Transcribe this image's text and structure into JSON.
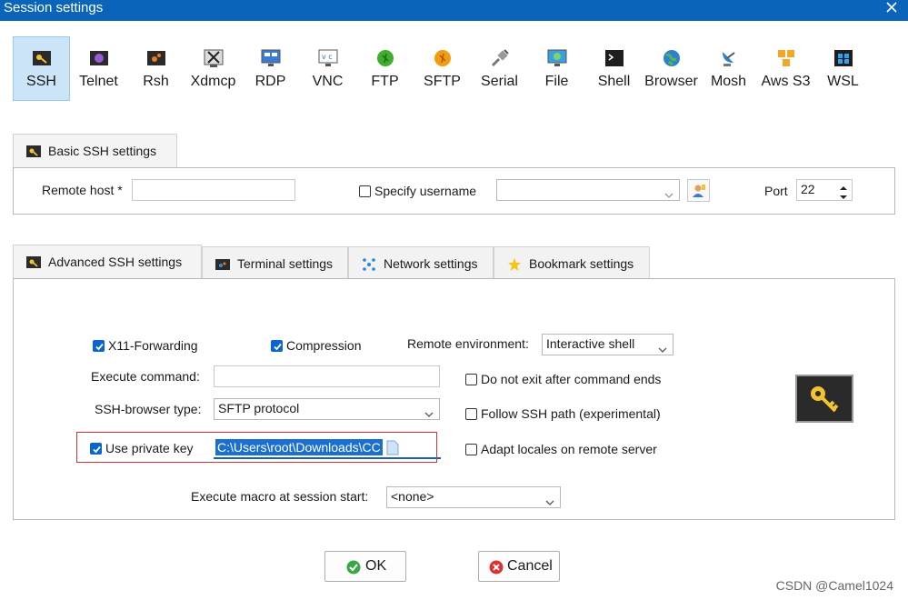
{
  "window": {
    "title": "Session settings",
    "accent": "#0a64b9"
  },
  "protocols": [
    {
      "label": "SSH",
      "icon": "ssh-key-icon",
      "active": true
    },
    {
      "label": "Telnet",
      "icon": "telnet-icon"
    },
    {
      "label": "Rsh",
      "icon": "rsh-icon"
    },
    {
      "label": "Xdmcp",
      "icon": "xdmcp-icon"
    },
    {
      "label": "RDP",
      "icon": "rdp-monitor-icon"
    },
    {
      "label": "VNC",
      "icon": "vnc-icon"
    },
    {
      "label": "FTP",
      "icon": "ftp-globe-icon"
    },
    {
      "label": "SFTP",
      "icon": "sftp-globe-icon"
    },
    {
      "label": "Serial",
      "icon": "serial-plug-icon"
    },
    {
      "label": "File",
      "icon": "file-monitor-icon"
    },
    {
      "label": "Shell",
      "icon": "shell-terminal-icon"
    },
    {
      "label": "Browser",
      "icon": "browser-globe-icon"
    },
    {
      "label": "Mosh",
      "icon": "mosh-satellite-icon"
    },
    {
      "label": "Aws S3",
      "icon": "aws-s3-cubes-icon"
    },
    {
      "label": "WSL",
      "icon": "wsl-windows-icon"
    }
  ],
  "basic": {
    "tab_label": "Basic SSH settings",
    "remote_host_label": "Remote host *",
    "remote_host_value": "",
    "specify_username_label": "Specify username",
    "specify_username_checked": false,
    "username_value": "",
    "port_label": "Port",
    "port_value": "22"
  },
  "advanced_tabs": [
    {
      "label": "Advanced SSH settings",
      "icon": "key-icon",
      "selected": true
    },
    {
      "label": "Terminal settings",
      "icon": "terminal-icon"
    },
    {
      "label": "Network settings",
      "icon": "network-icon"
    },
    {
      "label": "Bookmark settings",
      "icon": "star-icon"
    }
  ],
  "advanced": {
    "x11_label": "X11-Forwarding",
    "x11_checked": true,
    "compression_label": "Compression",
    "compression_checked": true,
    "remote_env_label": "Remote environment:",
    "remote_env_value": "Interactive shell",
    "execute_command_label": "Execute command:",
    "execute_command_value": "",
    "no_exit_label": "Do not exit after command ends",
    "no_exit_checked": false,
    "browser_type_label": "SSH-browser type:",
    "browser_type_value": "SFTP protocol",
    "follow_path_label": "Follow SSH path (experimental)",
    "follow_path_checked": false,
    "private_key_label": "Use private key",
    "private_key_checked": true,
    "private_key_value": "C:\\Users\\root\\Downloads\\CC",
    "adapt_locales_label": "Adapt locales on remote server",
    "adapt_locales_checked": false,
    "macro_label": "Execute macro at session start:",
    "macro_value": "<none>"
  },
  "buttons": {
    "ok": "OK",
    "cancel": "Cancel"
  },
  "watermark": "CSDN @Camel1024",
  "colors": {
    "active_tile": "#cce4f7",
    "checkbox": "#0a64d2",
    "highlight": "#d7323a"
  }
}
